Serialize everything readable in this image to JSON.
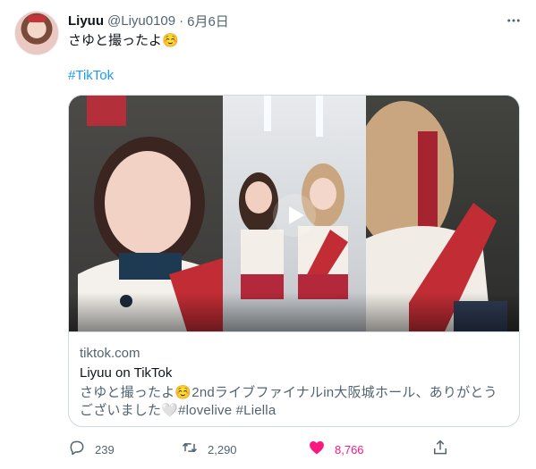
{
  "user": {
    "name": "Liyuu",
    "handle": "@Liyu0109",
    "separator": "·",
    "date": "6月6日"
  },
  "tweet": {
    "text": "さゆと撮ったよ☺️",
    "hashtag": "#TikTok"
  },
  "card": {
    "domain": "tiktok.com",
    "title": "Liyuu on TikTok",
    "description": "さゆと撮ったよ☺️2ndライブファイナルin大阪城ホール、ありがとうございました🤍#lovelive #Liella"
  },
  "actions": {
    "reply_count": "239",
    "retweet_count": "2,290",
    "like_count": "8,766"
  },
  "colors": {
    "accent": "#1d9bf0",
    "like": "#f91880",
    "muted": "#536471"
  },
  "icons": [
    "more-icon",
    "play-icon",
    "reply-icon",
    "retweet-icon",
    "heart-icon",
    "share-icon"
  ]
}
